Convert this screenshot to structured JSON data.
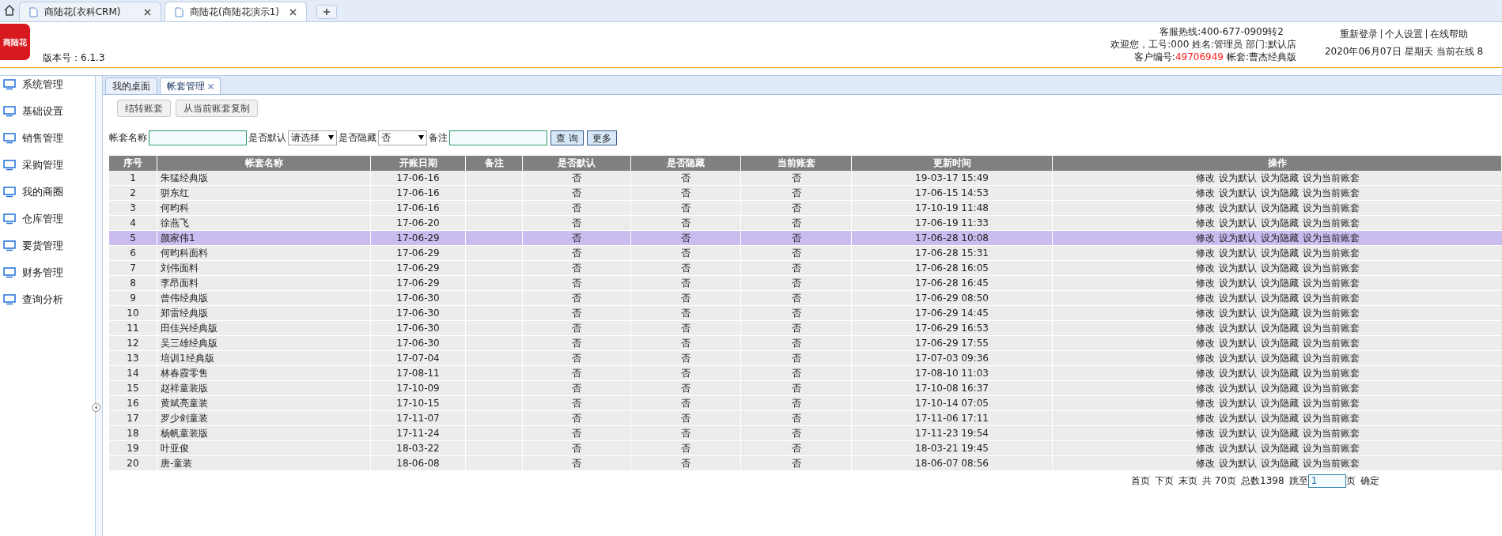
{
  "browser_tabs": [
    {
      "title": "商陆花(衣科CRM)",
      "selected": false
    },
    {
      "title": "商陆花(商陆花演示1)",
      "selected": true
    }
  ],
  "header": {
    "logo_text": "商陆花",
    "version": "版本号：6.1.3",
    "hotline": "客服热线:400-677-0909转2",
    "welcome": "欢迎您，工号:000 姓名:管理员 部门:默认店",
    "customer_label": "客户编号:",
    "customer_no": "49706949",
    "account": "帐套:曹杰经典版",
    "links": [
      "重新登录",
      "个人设置",
      "在线帮助"
    ],
    "date_line": "2020年06月07日 星期天 当前在线 8"
  },
  "sidebar": {
    "items": [
      {
        "label": "系统管理"
      },
      {
        "label": "基础设置"
      },
      {
        "label": "销售管理"
      },
      {
        "label": "采购管理"
      },
      {
        "label": "我的商圈"
      },
      {
        "label": "仓库管理"
      },
      {
        "label": "要货管理"
      },
      {
        "label": "财务管理"
      },
      {
        "label": "查询分析"
      }
    ]
  },
  "page_tabs": [
    {
      "label": "我的桌面",
      "selected": false,
      "closable": false
    },
    {
      "label": "帐套管理",
      "selected": true,
      "closable": true
    }
  ],
  "toolbar": [
    "结转账套",
    "从当前账套复制"
  ],
  "filters": {
    "name_label": "帐套名称",
    "default_label": "是否默认",
    "default_value": "请选择",
    "hidden_label": "是否隐藏",
    "hidden_value": "否",
    "note_label": "备注",
    "buttons": [
      "查 询",
      "更多"
    ]
  },
  "table": {
    "columns": [
      "序号",
      "帐套名称",
      "开账日期",
      "备注",
      "是否默认",
      "是否隐藏",
      "当前账套",
      "更新时间",
      "操作"
    ],
    "rows": [
      {
        "cells": [
          "1",
          "朱猛经典版",
          "17-06-16",
          "",
          "否",
          "否",
          "否",
          "19-03-17 15:49"
        ],
        "actions": [
          "修改",
          "设为默认",
          "设为隐藏",
          "设为当前账套"
        ],
        "selected": false
      },
      {
        "cells": [
          "2",
          "骈东红",
          "17-06-16",
          "",
          "否",
          "否",
          "否",
          "17-06-15 14:53"
        ],
        "actions": [
          "修改",
          "设为默认",
          "设为隐藏",
          "设为当前账套"
        ],
        "selected": false
      },
      {
        "cells": [
          "3",
          "何昀科",
          "17-06-16",
          "",
          "否",
          "否",
          "否",
          "17-10-19 11:48"
        ],
        "actions": [
          "修改",
          "设为默认",
          "设为隐藏",
          "设为当前账套"
        ],
        "selected": false
      },
      {
        "cells": [
          "4",
          "徐燕飞",
          "17-06-20",
          "",
          "否",
          "否",
          "否",
          "17-06-19 11:33"
        ],
        "actions": [
          "修改",
          "设为默认",
          "设为隐藏",
          "设为当前账套"
        ],
        "selected": false
      },
      {
        "cells": [
          "5",
          "颜家伟1",
          "17-06-29",
          "",
          "否",
          "否",
          "否",
          "17-06-28 10:08"
        ],
        "actions": [
          "修改",
          "设为默认",
          "设为隐藏",
          "设为当前账套"
        ],
        "selected": true
      },
      {
        "cells": [
          "6",
          "何昀科面料",
          "17-06-29",
          "",
          "否",
          "否",
          "否",
          "17-06-28 15:31"
        ],
        "actions": [
          "修改",
          "设为默认",
          "设为隐藏",
          "设为当前账套"
        ],
        "selected": false
      },
      {
        "cells": [
          "7",
          "刘伟面料",
          "17-06-29",
          "",
          "否",
          "否",
          "否",
          "17-06-28 16:05"
        ],
        "actions": [
          "修改",
          "设为默认",
          "设为隐藏",
          "设为当前账套"
        ],
        "selected": false
      },
      {
        "cells": [
          "8",
          "李昂面料",
          "17-06-29",
          "",
          "否",
          "否",
          "否",
          "17-06-28 16:45"
        ],
        "actions": [
          "修改",
          "设为默认",
          "设为隐藏",
          "设为当前账套"
        ],
        "selected": false
      },
      {
        "cells": [
          "9",
          "曾伟经典版",
          "17-06-30",
          "",
          "否",
          "否",
          "否",
          "17-06-29 08:50"
        ],
        "actions": [
          "修改",
          "设为默认",
          "设为隐藏",
          "设为当前账套"
        ],
        "selected": false
      },
      {
        "cells": [
          "10",
          "郑雷经典版",
          "17-06-30",
          "",
          "否",
          "否",
          "否",
          "17-06-29 14:45"
        ],
        "actions": [
          "修改",
          "设为默认",
          "设为隐藏",
          "设为当前账套"
        ],
        "selected": false
      },
      {
        "cells": [
          "11",
          "田佳兴经典版",
          "17-06-30",
          "",
          "否",
          "否",
          "否",
          "17-06-29 16:53"
        ],
        "actions": [
          "修改",
          "设为默认",
          "设为隐藏",
          "设为当前账套"
        ],
        "selected": false
      },
      {
        "cells": [
          "12",
          "吴三雄经典版",
          "17-06-30",
          "",
          "否",
          "否",
          "否",
          "17-06-29 17:55"
        ],
        "actions": [
          "修改",
          "设为默认",
          "设为隐藏",
          "设为当前账套"
        ],
        "selected": false
      },
      {
        "cells": [
          "13",
          "培训1经典版",
          "17-07-04",
          "",
          "否",
          "否",
          "否",
          "17-07-03 09:36"
        ],
        "actions": [
          "修改",
          "设为默认",
          "设为隐藏",
          "设为当前账套"
        ],
        "selected": false
      },
      {
        "cells": [
          "14",
          "林春霞零售",
          "17-08-11",
          "",
          "否",
          "否",
          "否",
          "17-08-10 11:03"
        ],
        "actions": [
          "修改",
          "设为默认",
          "设为隐藏",
          "设为当前账套"
        ],
        "selected": false
      },
      {
        "cells": [
          "15",
          "赵祥童装版",
          "17-10-09",
          "",
          "否",
          "否",
          "否",
          "17-10-08 16:37"
        ],
        "actions": [
          "修改",
          "设为默认",
          "设为隐藏",
          "设为当前账套"
        ],
        "selected": false
      },
      {
        "cells": [
          "16",
          "黄斌亮童装",
          "17-10-15",
          "",
          "否",
          "否",
          "否",
          "17-10-14 07:05"
        ],
        "actions": [
          "修改",
          "设为默认",
          "设为隐藏",
          "设为当前账套"
        ],
        "selected": false
      },
      {
        "cells": [
          "17",
          "罗少剑童装",
          "17-11-07",
          "",
          "否",
          "否",
          "否",
          "17-11-06 17:11"
        ],
        "actions": [
          "修改",
          "设为默认",
          "设为隐藏",
          "设为当前账套"
        ],
        "selected": false
      },
      {
        "cells": [
          "18",
          "杨帆童装版",
          "17-11-24",
          "",
          "否",
          "否",
          "否",
          "17-11-23 19:54"
        ],
        "actions": [
          "修改",
          "设为默认",
          "设为隐藏",
          "设为当前账套"
        ],
        "selected": false
      },
      {
        "cells": [
          "19",
          "叶亚俊",
          "18-03-22",
          "",
          "否",
          "否",
          "否",
          "18-03-21 19:45"
        ],
        "actions": [
          "修改",
          "设为默认",
          "设为隐藏",
          "设为当前账套"
        ],
        "selected": false
      },
      {
        "cells": [
          "20",
          "唐-童装",
          "18-06-08",
          "",
          "否",
          "否",
          "否",
          "18-06-07 08:56"
        ],
        "actions": [
          "修改",
          "设为默认",
          "设为隐藏",
          "设为当前账套"
        ],
        "selected": false
      }
    ]
  },
  "pagination": {
    "links": [
      "首页",
      "下页",
      "末页"
    ],
    "total_pages": "共 70页",
    "total_count": "总数1398",
    "jump_label": "跳至",
    "page_value": "1",
    "page_suffix": "页",
    "confirm": "确定"
  }
}
